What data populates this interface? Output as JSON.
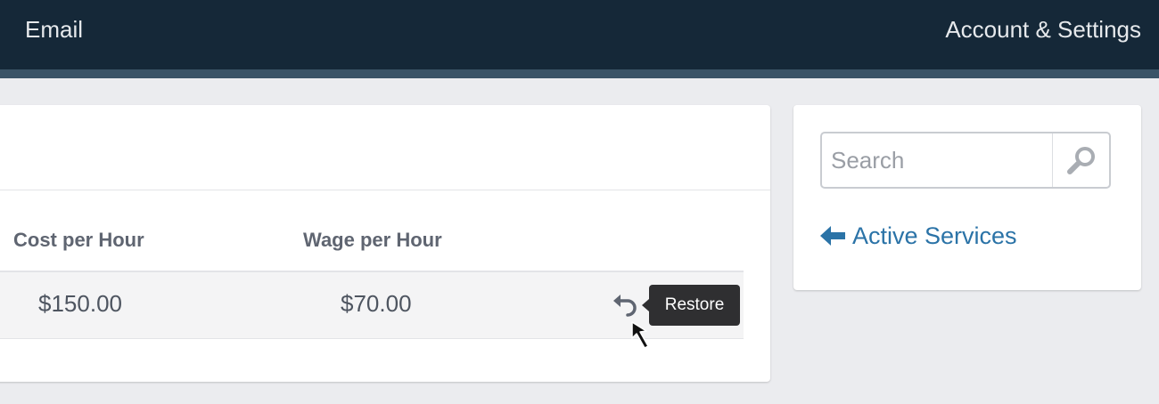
{
  "nav": {
    "email": "Email",
    "account": "Account & Settings"
  },
  "table": {
    "headers": {
      "cost": "Cost per Hour",
      "wage": "Wage per Hour"
    },
    "rows": [
      {
        "cost": "$150.00",
        "wage": "$70.00"
      }
    ],
    "restore_icon": "undo-icon",
    "tooltip": "Restore"
  },
  "sidebar": {
    "search_placeholder": "Search",
    "search_icon": "magnifier-icon",
    "back_icon": "arrow-left-icon",
    "back_link": "Active Services"
  },
  "colors": {
    "topbar": "#152838",
    "topbar_accent": "#3b5467",
    "link": "#2b73a7",
    "tooltip_bg": "#2f2f31"
  }
}
